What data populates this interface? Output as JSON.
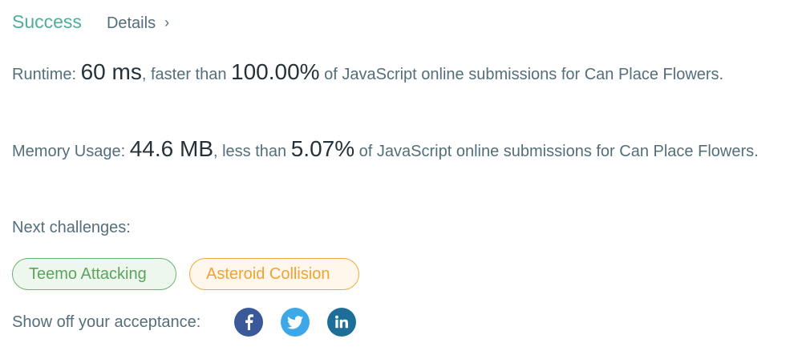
{
  "header": {
    "status": "Success",
    "details_label": "Details",
    "chevron": "›"
  },
  "runtime": {
    "label": "Runtime: ",
    "value": "60 ms",
    "mid": ", faster than ",
    "percent": "100.00%",
    "suffix": " of JavaScript online submissions for Can Place Flowers."
  },
  "memory": {
    "label": "Memory Usage: ",
    "value": "44.6 MB",
    "mid": ", less than ",
    "percent": "5.07%",
    "suffix": " of JavaScript online submissions for Can Place Flowers."
  },
  "next": {
    "label": "Next challenges:",
    "challenges": [
      {
        "title": "Teemo Attacking",
        "difficulty_color": "#5aa55d"
      },
      {
        "title": "Asteroid Collision",
        "difficulty_color": "#f0a232"
      }
    ]
  },
  "share": {
    "label": "Show off your acceptance:",
    "icons": [
      "facebook-icon",
      "twitter-icon",
      "linkedin-icon"
    ]
  }
}
